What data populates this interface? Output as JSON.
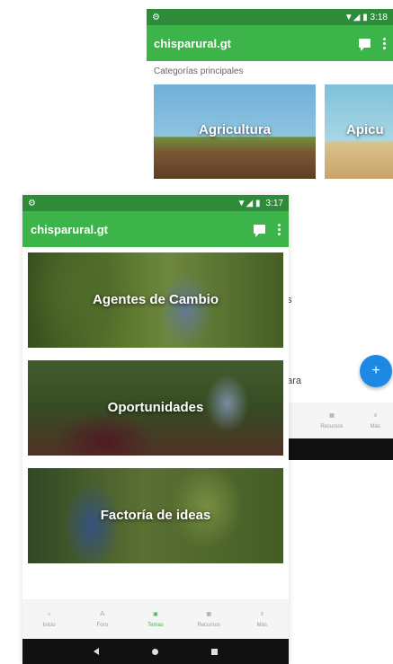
{
  "back_screen": {
    "status": {
      "left": "⚙",
      "time": "3:18"
    },
    "app_title": "chisparural.gt",
    "section_title": "Categorías principales",
    "categories": [
      {
        "label": "Agricultura"
      },
      {
        "label": "Apicu"
      }
    ],
    "peek_texts": [
      "es",
      "para"
    ],
    "fab_label": "+",
    "nav_items": [
      {
        "label": "Recursos",
        "icon": "book-icon"
      },
      {
        "label": "Más",
        "icon": "menu-icon"
      }
    ]
  },
  "front_screen": {
    "status": {
      "left": "⚙",
      "time": "3:17"
    },
    "app_title": "chisparural.gt",
    "topics": [
      {
        "label": "Agentes de Cambio"
      },
      {
        "label": "Oportunidades"
      },
      {
        "label": "Factoría de ideas"
      }
    ],
    "nav_items": [
      {
        "label": "Inicio",
        "icon": "home-icon"
      },
      {
        "label": "Foro",
        "icon": "people-icon"
      },
      {
        "label": "Temas",
        "icon": "topics-icon",
        "active": true
      },
      {
        "label": "Recursos",
        "icon": "book-icon"
      },
      {
        "label": "Más",
        "icon": "menu-icon"
      }
    ]
  },
  "colors": {
    "status_bar": "#2e8b3a",
    "app_bar": "#3cb44a",
    "fab": "#1e88e5",
    "active_nav": "#3cb44a"
  }
}
